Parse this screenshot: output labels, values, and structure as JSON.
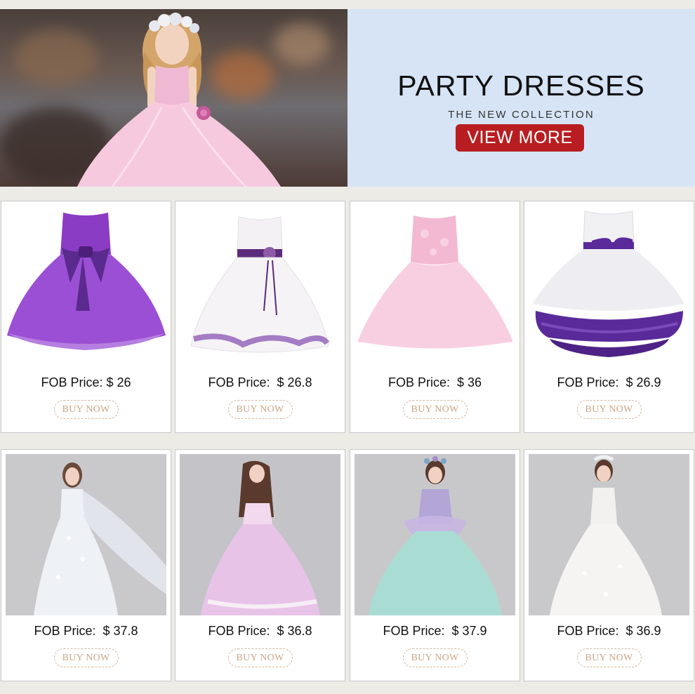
{
  "hero": {
    "title": "PARTY DRESSES",
    "subtitle": "THE NEW COLLECTION",
    "button_label": "VIEW MORE"
  },
  "products": [
    {
      "price_label": "FOB Price: $ 26",
      "button_label": "BUY NOW",
      "dress_color": "#8e3fc8"
    },
    {
      "price_label": "FOB Price:  $ 26.8",
      "button_label": "BUY NOW",
      "dress_color": "#f3f0f2"
    },
    {
      "price_label": "FOB Price:  $ 36",
      "button_label": "BUY NOW",
      "dress_color": "#f6c4da"
    },
    {
      "price_label": "FOB Price:  $ 26.9",
      "button_label": "BUY NOW",
      "dress_color": "#5a2a9a"
    },
    {
      "price_label": "FOB Price:  $ 37.8",
      "button_label": "BUY NOW",
      "dress_color": "#e8ecf2"
    },
    {
      "price_label": "FOB Price:  $ 36.8",
      "button_label": "BUY NOW",
      "dress_color": "#e6bfe6"
    },
    {
      "price_label": "FOB Price:  $ 37.9",
      "button_label": "BUY NOW",
      "dress_color": "#a9ddd4"
    },
    {
      "price_label": "FOB Price:  $ 36.9",
      "button_label": "BUY NOW",
      "dress_color": "#f4f3f2"
    }
  ],
  "colors": {
    "accent_red": "#b81e21",
    "banner_blue": "#d6e4f6",
    "buy_now_gold": "#caa786"
  }
}
